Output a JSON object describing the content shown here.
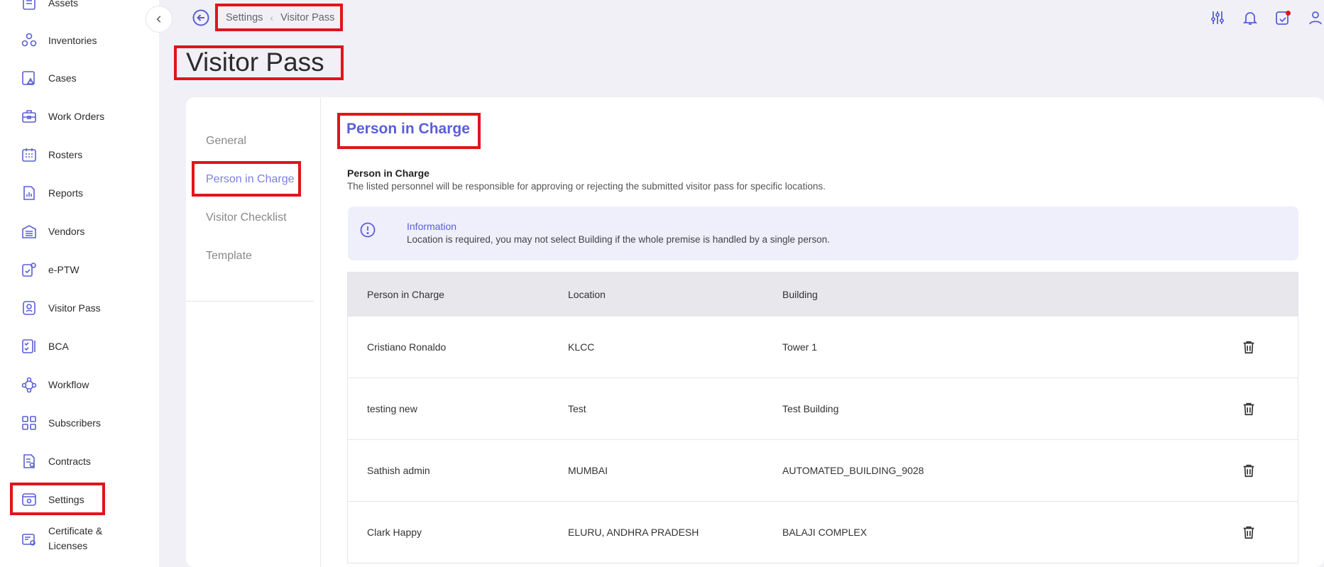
{
  "sidebar": {
    "items": [
      {
        "label": "Assets",
        "icon": "assets-icon"
      },
      {
        "label": "Inventories",
        "icon": "inventories-icon"
      },
      {
        "label": "Cases",
        "icon": "cases-icon"
      },
      {
        "label": "Work Orders",
        "icon": "work-orders-icon"
      },
      {
        "label": "Rosters",
        "icon": "rosters-icon"
      },
      {
        "label": "Reports",
        "icon": "reports-icon"
      },
      {
        "label": "Vendors",
        "icon": "vendors-icon"
      },
      {
        "label": "e-PTW",
        "icon": "eptw-icon"
      },
      {
        "label": "Visitor Pass",
        "icon": "visitor-pass-icon"
      },
      {
        "label": "BCA",
        "icon": "bca-icon"
      },
      {
        "label": "Workflow",
        "icon": "workflow-icon"
      },
      {
        "label": "Subscribers",
        "icon": "subscribers-icon"
      },
      {
        "label": "Contracts",
        "icon": "contracts-icon"
      },
      {
        "label": "Settings",
        "icon": "settings-icon"
      },
      {
        "label_line1": "Certificate &",
        "label_line2": "Licenses",
        "icon": "certificate-icon"
      }
    ]
  },
  "breadcrumb": {
    "root": "Settings",
    "current": "Visitor Pass"
  },
  "page": {
    "title": "Visitor Pass"
  },
  "subnav": {
    "items": [
      {
        "label": "General"
      },
      {
        "label": "Person in Charge"
      },
      {
        "label": "Visitor Checklist"
      },
      {
        "label": "Template"
      }
    ]
  },
  "section": {
    "title": "Person in Charge",
    "heading": "Person in Charge",
    "description": "The listed personnel will be responsible for approving or rejecting the submitted visitor pass for specific locations."
  },
  "info": {
    "title": "Information",
    "text": "Location is required, you may not select Building if the whole premise is handled by a single person."
  },
  "table": {
    "headers": [
      "Person in Charge",
      "Location",
      "Building"
    ],
    "rows": [
      [
        "Cristiano Ronaldo",
        "KLCC",
        "Tower 1"
      ],
      [
        "testing new",
        "Test",
        "Test Building"
      ],
      [
        "Sathish admin",
        "MUMBAI",
        "AUTOMATED_BUILDING_9028"
      ],
      [
        "Clark Happy",
        "ELURU, ANDHRA PRADESH",
        "BALAJI COMPLEX"
      ]
    ]
  },
  "colors": {
    "accent": "#5a5fd6",
    "highlight": "#e0151b"
  }
}
